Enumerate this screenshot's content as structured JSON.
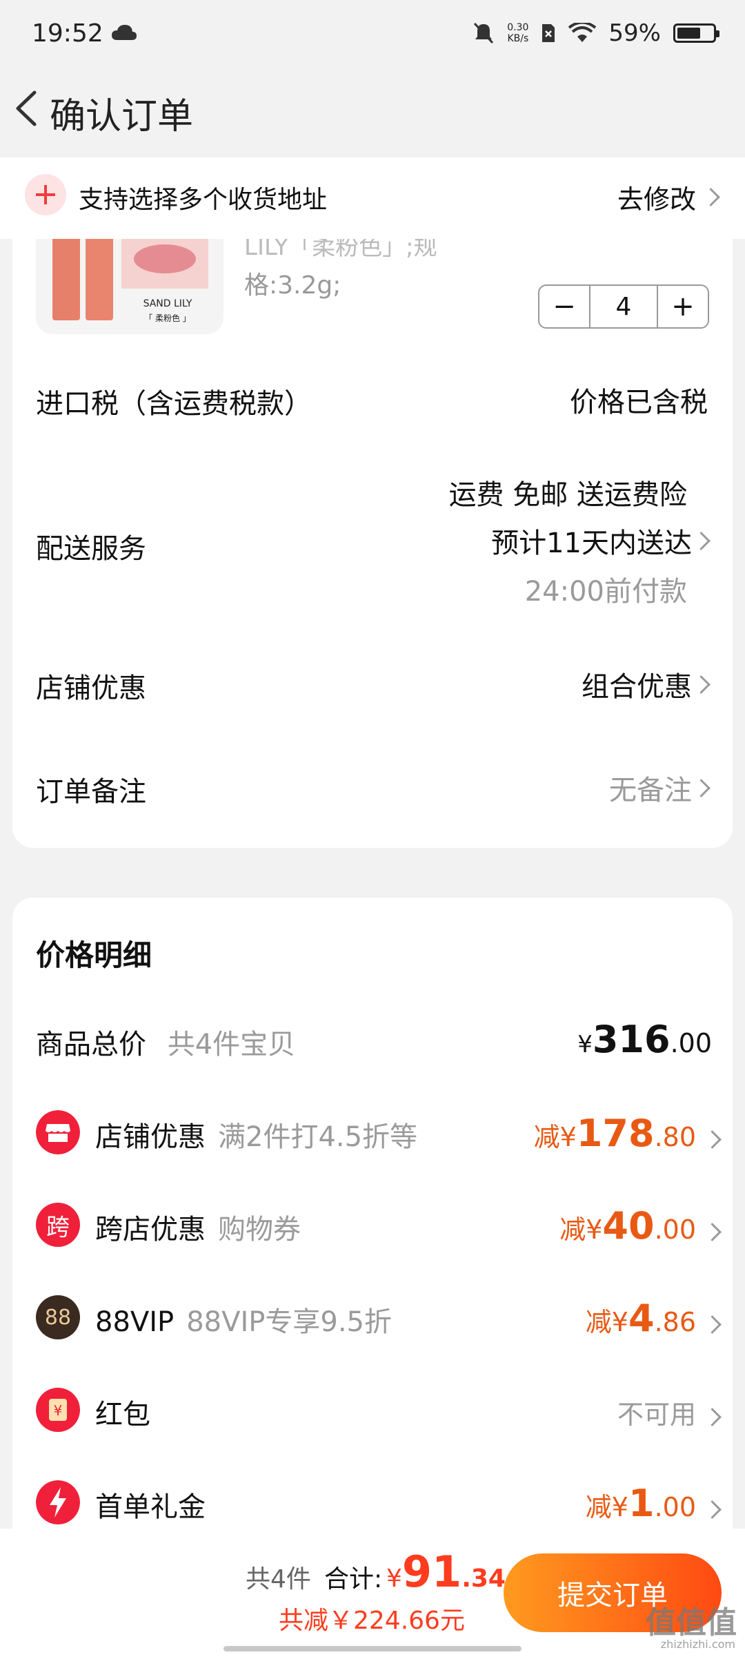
{
  "status_bar": {
    "time": "19:52",
    "net_speed_value": "0.30",
    "net_speed_unit": "KB/s",
    "battery": "59%"
  },
  "nav": {
    "title": "确认订单"
  },
  "address": {
    "text": "支持选择多个收货地址",
    "modify": "去修改"
  },
  "product": {
    "spec_line1": "LILY「柔粉色」;规",
    "spec_line2": "格:3.2g;",
    "thumb_brand": "SAND LILY",
    "thumb_sub": "「 柔粉色 」",
    "quantity": "4",
    "minus": "−",
    "plus": "+"
  },
  "rows": {
    "tax_label": "进口税（含运费税款）",
    "tax_value": "价格已含税",
    "shipping_label": "配送服务",
    "shipping_line1": "运费 免邮 送运费险",
    "shipping_line2": "预计11天内送达",
    "shipping_line3": "24:00前付款",
    "shop_discount_label": "店铺优惠",
    "shop_discount_value": "组合优惠",
    "note_label": "订单备注",
    "note_value": "无备注"
  },
  "price_detail": {
    "title": "价格明细",
    "total_label": "商品总价",
    "total_desc": "共4件宝贝",
    "total_currency": "¥",
    "total_int": "316",
    "total_dec": ".00",
    "items": [
      {
        "label": "店铺优惠",
        "desc": "满2件打4.5折等",
        "prefix": "减",
        "currency": "¥",
        "int": "178",
        "dec": ".80",
        "icon": "shop-icon"
      },
      {
        "label": "跨店优惠",
        "desc": "购物券",
        "prefix": "减",
        "currency": "¥",
        "int": "40",
        "dec": ".00",
        "icon": "cross-store-icon",
        "icon_text": "跨"
      },
      {
        "label": "88VIP",
        "desc": "88VIP专享9.5折",
        "prefix": "减",
        "currency": "¥",
        "int": "4",
        "dec": ".86",
        "icon": "vip-icon",
        "icon_text": "88"
      },
      {
        "label": "红包",
        "desc": "",
        "value": "不可用",
        "icon": "red-packet-icon",
        "icon_text": "¥"
      },
      {
        "label": "首单礼金",
        "desc": "",
        "prefix": "减",
        "currency": "¥",
        "int": "1",
        "dec": ".00",
        "icon": "lightning-icon"
      }
    ]
  },
  "bottom": {
    "count": "共4件",
    "total_label": "合计:",
    "currency": "¥",
    "total_int": "91",
    "total_dec": ".34",
    "saved": "共减￥224.66元",
    "submit": "提交订单",
    "watermark": "值值值",
    "watermark_sub": "zhizhizhi.com"
  },
  "colors": {
    "accent": "#e85a14",
    "submit_gradient_start": "#ff9a1f",
    "submit_gradient_end": "#ff4a12",
    "red_icon": "#f0203a",
    "vip_icon": "#3a2a20"
  }
}
